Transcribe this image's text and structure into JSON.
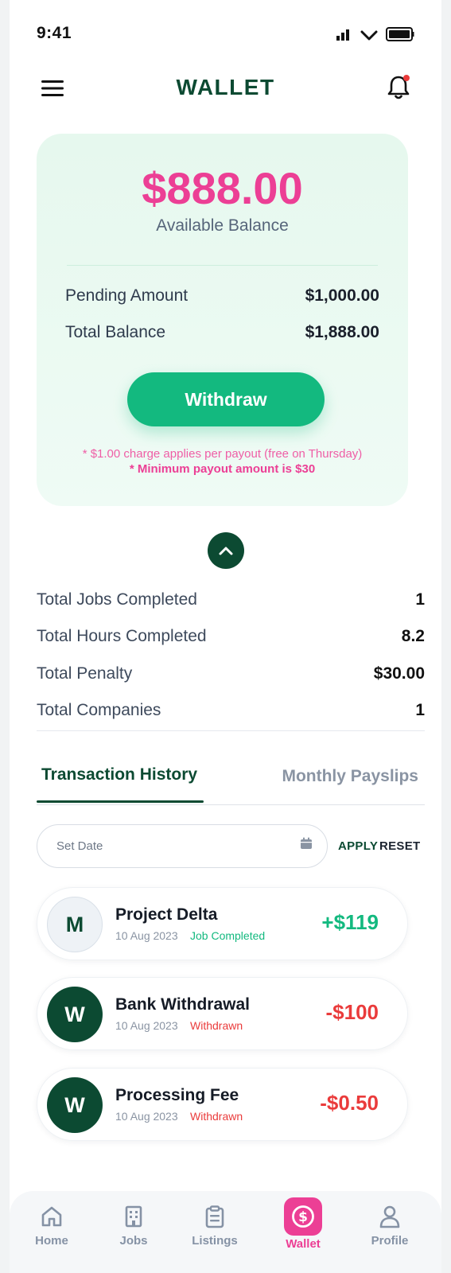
{
  "status_bar": {
    "time": "9:41"
  },
  "header": {
    "title": "WALLET"
  },
  "balance_card": {
    "amount": "$888.00",
    "amount_label": "Available Balance",
    "rows": [
      {
        "label": "Pending Amount",
        "value": "$1,000.00"
      },
      {
        "label": "Total Balance",
        "value": "$1,888.00"
      }
    ],
    "withdraw_label": "Withdraw",
    "note_fee": "* $1.00 charge applies per payout (free on Thursday)",
    "note_min": "* Minimum payout amount is $30"
  },
  "stats": [
    {
      "label": "Total Jobs Completed",
      "value": "1"
    },
    {
      "label": "Total Hours Completed",
      "value": "8.2"
    },
    {
      "label": "Total Penalty",
      "value": "$30.00"
    },
    {
      "label": "Total Companies",
      "value": "1"
    }
  ],
  "tabs": [
    {
      "label": "Transaction History",
      "active": true
    },
    {
      "label": "Monthly Payslips",
      "active": false
    }
  ],
  "filter": {
    "date_placeholder": "Set Date",
    "apply_label": "APPLY",
    "reset_label": "RESET"
  },
  "transactions": [
    {
      "initial": "M",
      "name": "Project Delta",
      "date": "10 Aug 2023",
      "status": "Job Completed",
      "amount": "+$119"
    },
    {
      "initial": "W",
      "name": "Bank Withdrawal",
      "date": "10 Aug 2023",
      "status": "Withdrawn",
      "amount": "-$100"
    },
    {
      "initial": "W",
      "name": "Processing Fee",
      "date": "10 Aug 2023",
      "status": "Withdrawn",
      "amount": "-$0.50"
    }
  ],
  "nav": [
    {
      "label": "Home",
      "icon": "home-icon"
    },
    {
      "label": "Jobs",
      "icon": "building-icon"
    },
    {
      "label": "Listings",
      "icon": "clipboard-icon"
    },
    {
      "label": "Wallet",
      "icon": "dollar-circle-icon",
      "active": true
    },
    {
      "label": "Profile",
      "icon": "user-icon"
    }
  ],
  "colors": {
    "brand_dark_green": "#0c4a32",
    "accent_pink": "#ec3f95",
    "button_green": "#13b97f",
    "negative_red": "#ea3b3b"
  }
}
